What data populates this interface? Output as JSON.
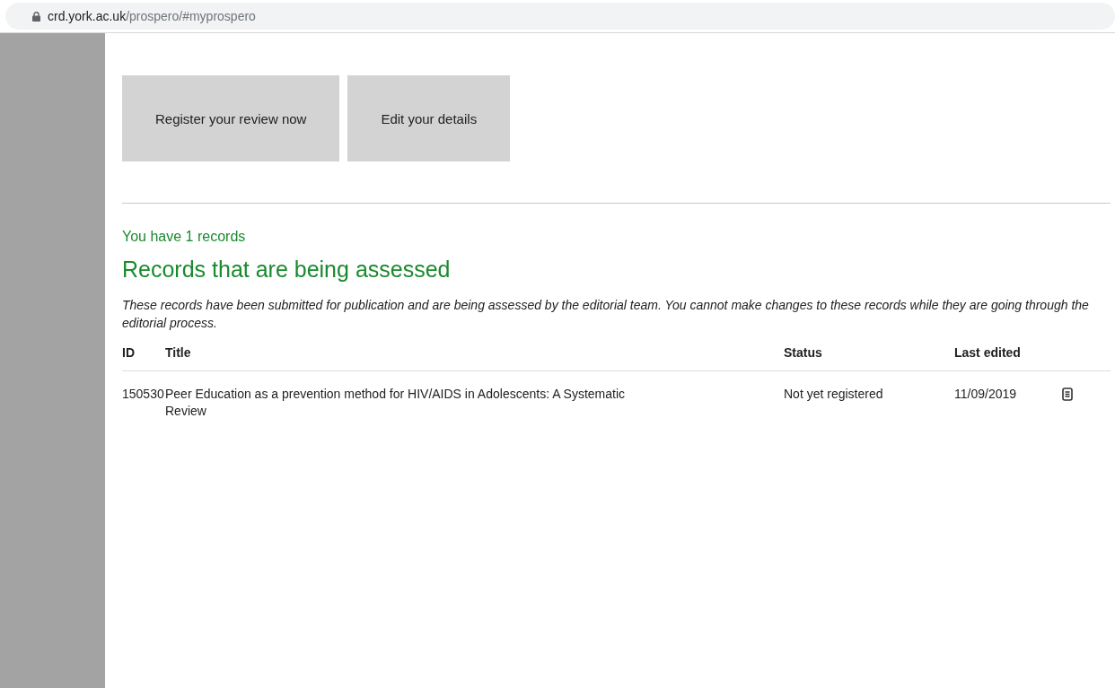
{
  "address_bar": {
    "host": "crd.york.ac.uk",
    "path": "/prospero/#myprospero"
  },
  "buttons": [
    "Register your review now",
    "Edit your details"
  ],
  "records_count": "You have 1 records",
  "section": {
    "heading": "Records that are being assessed",
    "description": "These records have been submitted for publication and are being assessed by the editorial team. You cannot make changes to these records while they are going through the editorial process."
  },
  "table": {
    "columns": [
      "ID",
      "Title",
      "Status",
      "Last edited"
    ],
    "rows": [
      {
        "id": "150530",
        "title": "Peer Education as a prevention method for HIV/AIDS in Adolescents: A Systematic Review",
        "status": "Not yet registered",
        "last_edited": "11/09/2019"
      }
    ]
  }
}
